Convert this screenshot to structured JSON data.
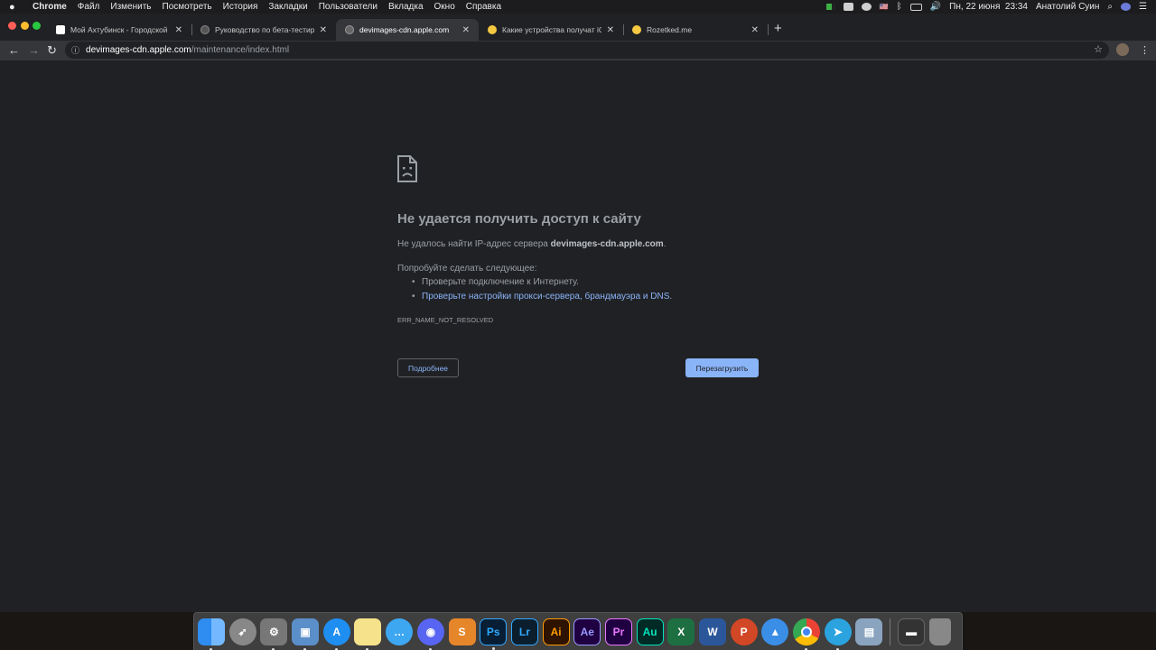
{
  "menubar": {
    "app_name": "Chrome",
    "items": [
      "Файл",
      "Изменить",
      "Посмотреть",
      "История",
      "Закладки",
      "Пользователи",
      "Вкладка",
      "Окно",
      "Справка"
    ],
    "flag": "🇺🇸",
    "datetime": "Пн, 22 июня  23:34",
    "user": "Анатолий Суин"
  },
  "tabs": [
    {
      "title": "Мой Ахтубинск - Городской Ᵽ",
      "active": false
    },
    {
      "title": "Руководство по бета-тестиро",
      "active": false
    },
    {
      "title": "devimages-cdn.apple.com",
      "active": true
    },
    {
      "title": "Какие устройства получат iOS",
      "active": false
    },
    {
      "title": "Rozetked.me",
      "active": false
    }
  ],
  "omnibox": {
    "host": "devimages-cdn.apple.com",
    "path": "/maintenance/index.html"
  },
  "error_page": {
    "title": "Не удается получить доступ к сайту",
    "line1_prefix": "Не удалось найти IP-адрес сервера ",
    "line1_host": "devimages-cdn.apple.com",
    "line1_suffix": ".",
    "try_heading": "Попробуйте сделать следующее:",
    "suggestion1": "Проверьте подключение к Интернету.",
    "suggestion2_link": "Проверьте настройки прокси-сервера, брандмауэра и DNS",
    "suggestion2_suffix": ".",
    "error_code": "ERR_NAME_NOT_RESOLVED",
    "details_button": "Подробнее",
    "reload_button": "Перезагрузить"
  },
  "colors": {
    "page_bg": "#202124",
    "link": "#8ab4f8",
    "button_primary": "#8ab4f8"
  },
  "dock": {
    "apps": [
      "Finder",
      "Launchpad",
      "System Preferences",
      "Preview",
      "App Store",
      "Notes",
      "Messages",
      "Discord",
      "Sublime Text",
      "Ps",
      "Lr",
      "Ai",
      "Ae",
      "Pr",
      "Au",
      "X",
      "W",
      "P",
      "Arc",
      "Chrome",
      "Telegram",
      "Screenshots",
      "Terminal",
      "Trash"
    ]
  }
}
